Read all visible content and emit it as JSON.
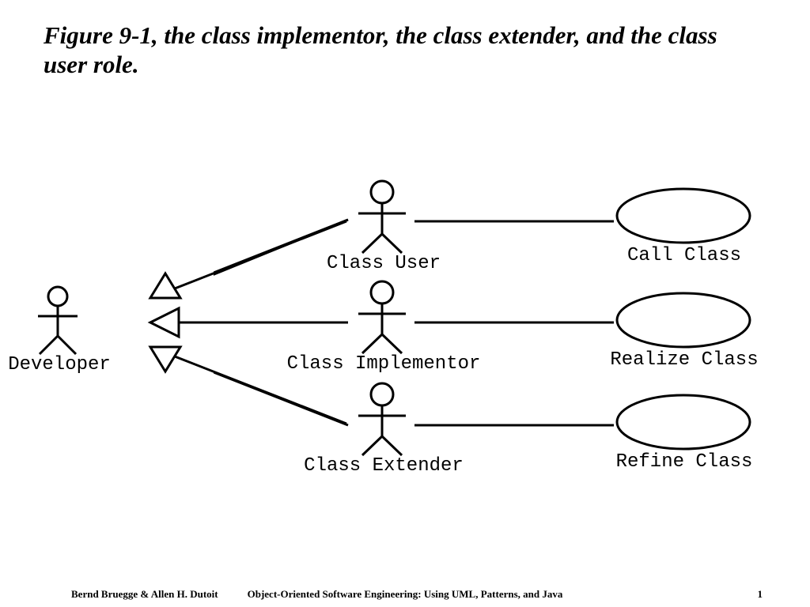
{
  "title": "Figure 9-1, the class implementor, the class extender, and the class user role.",
  "actors": {
    "developer": "Developer",
    "class_user": "Class User",
    "class_implementor": "Class Implementor",
    "class_extender": "Class Extender"
  },
  "usecases": {
    "call_class": "Call Class",
    "realize_class": "Realize Class",
    "refine_class": "Refine Class"
  },
  "footer": {
    "left": "Bernd Bruegge & Allen H. Dutoit",
    "center": "Object-Oriented Software Engineering: Using UML, Patterns, and Java",
    "right": "1"
  },
  "diagram_semantics": {
    "generalizations": [
      {
        "child": "Class User",
        "parent": "Developer"
      },
      {
        "child": "Class Implementor",
        "parent": "Developer"
      },
      {
        "child": "Class Extender",
        "parent": "Developer"
      }
    ],
    "associations": [
      {
        "actor": "Class User",
        "usecase": "Call Class"
      },
      {
        "actor": "Class Implementor",
        "usecase": "Realize Class"
      },
      {
        "actor": "Class Extender",
        "usecase": "Refine Class"
      }
    ]
  }
}
